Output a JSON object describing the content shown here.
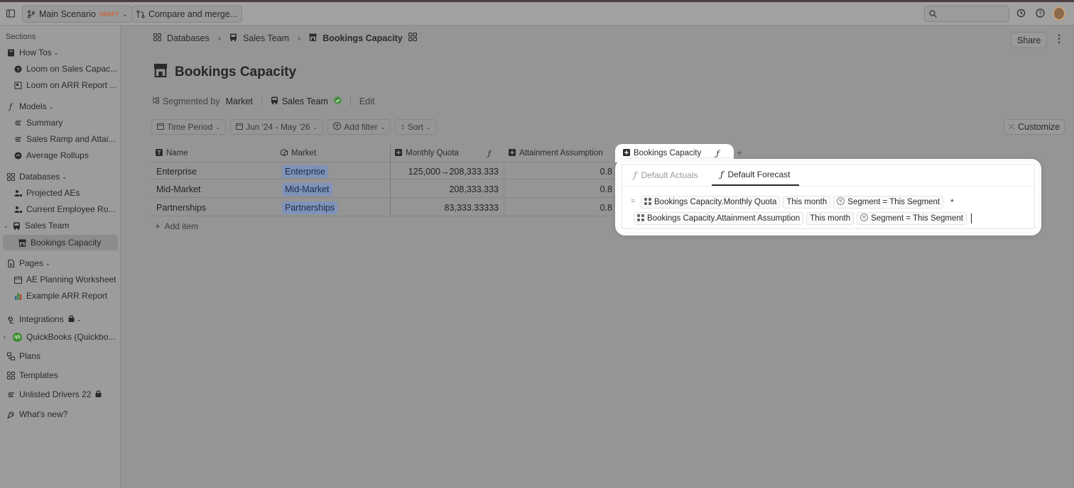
{
  "topbar": {
    "scenario_name": "Main Scenario",
    "scenario_badge": "DRAFT",
    "compare_label": "Compare and merge...",
    "search_placeholder": ""
  },
  "sidebar": {
    "sections_label": "Sections",
    "how_tos": "How Tos",
    "how_tos_items": [
      "Loom on Sales Capac...",
      "Loom on ARR Report ..."
    ],
    "models": "Models",
    "models_items": [
      "Summary",
      "Sales Ramp and Attai...",
      "Average Rollups"
    ],
    "databases": "Databases",
    "databases_items": [
      "Projected AEs",
      "Current Employee Ro...",
      "Sales Team"
    ],
    "databases_subitem": "Bookings Capacity",
    "pages": "Pages",
    "pages_items": [
      "AE Planning Worksheet",
      "Example ARR Report"
    ],
    "integrations": "Integrations",
    "quickbooks": "QuickBooks (Quickbo...",
    "plans": "Plans",
    "templates": "Templates",
    "unlisted_drivers": "Unlisted Drivers 22",
    "whats_new": "What's new?"
  },
  "breadcrumb": {
    "items": [
      "Databases",
      "Sales Team",
      "Bookings Capacity"
    ]
  },
  "header": {
    "share_label": "Share",
    "page_title": "Bookings Capacity",
    "segmented_by_label": "Segmented by",
    "segment_value": "Market",
    "segment_source": "Sales Team",
    "edit_label": "Edit",
    "customize_label": "Customize"
  },
  "filters": {
    "time_period": "Time Period",
    "date_range": "Jun '24 - May '26",
    "add_filter": "Add filter",
    "sort": "Sort"
  },
  "table": {
    "columns": [
      "Name",
      "Market",
      "Monthly Quota",
      "Attainment Assumption",
      "Bookings Capacity"
    ],
    "rows": [
      {
        "name": "Enterprise",
        "market": "Enterprise",
        "quota": "125,000→208,333.333",
        "attainment": "0.8"
      },
      {
        "name": "Mid-Market",
        "market": "Mid-Market",
        "quota": "208,333.333",
        "attainment": "0.8"
      },
      {
        "name": "Partnerships",
        "market": "Partnerships",
        "quota": "83,333.33333",
        "attainment": "0.8"
      }
    ],
    "add_item": "Add item"
  },
  "formula_popup": {
    "tabs": [
      "Default Actuals",
      "Default Forecast"
    ],
    "active_tab": "Default Forecast",
    "equals": "=",
    "line1": {
      "ref": "Bookings Capacity.Monthly Quota",
      "period": "This month",
      "filter": "Segment = This Segment",
      "operator": "*"
    },
    "line2": {
      "ref": "Bookings Capacity.Attainment Assumption",
      "period": "This month",
      "filter": "Segment = This Segment"
    }
  },
  "colors": {
    "tag_bg": "#7f93b9",
    "check_green": "#3f8f3a",
    "draft_orange": "#c7653c"
  }
}
